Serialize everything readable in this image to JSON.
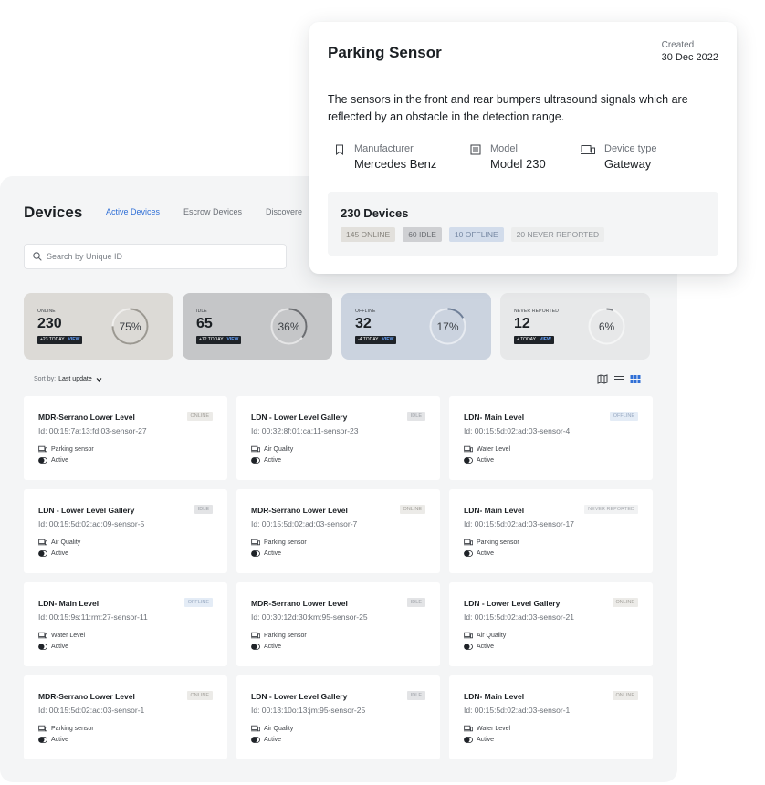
{
  "devices": {
    "title": "Devices",
    "tabs": [
      {
        "label": "Active Devices",
        "active": true
      },
      {
        "label": "Escrow Devices",
        "active": false
      },
      {
        "label": "Discovere",
        "active": false
      }
    ],
    "search": {
      "placeholder": "Search by Unique ID"
    },
    "stats": [
      {
        "label": "ONLINE",
        "value": "230",
        "badge": "+23 TODAY",
        "view": "VIEW",
        "percent": 75,
        "percent_label": "75%",
        "bg": "#dcdad6",
        "ring": "#9b9891"
      },
      {
        "label": "IDLE",
        "value": "65",
        "badge": "+12 TODAY",
        "view": "VIEW",
        "percent": 36,
        "percent_label": "36%",
        "bg": "#c5c6c8",
        "ring": "#6b6d71"
      },
      {
        "label": "OFFLINE",
        "value": "32",
        "badge": "-4 TODAY",
        "view": "VIEW",
        "percent": 17,
        "percent_label": "17%",
        "bg": "#cbd3df",
        "ring": "#6f7f98"
      },
      {
        "label": "NEVER REPORTED",
        "value": "12",
        "badge": "+ TODAY",
        "view": "VIEW",
        "percent": 6,
        "percent_label": "6%",
        "bg": "#e7e8e9",
        "ring": "#7f8287"
      }
    ],
    "sort": {
      "label": "Sort by:",
      "value": "Last update"
    },
    "cards": [
      {
        "name": "MDR-Serrano Lower Level",
        "id": "Id: 00:15:7a:13:fd:03-sensor-27",
        "status": "ONLINE",
        "kind": "online",
        "type": "Parking sensor",
        "state": "Active"
      },
      {
        "name": "LDN - Lower Level Gallery",
        "id": "Id: 00:32:8f:01:ca:11-sensor-23",
        "status": "IDLE",
        "kind": "idle",
        "type": "Air Quality",
        "state": "Active"
      },
      {
        "name": "LDN- Main Level",
        "id": "Id: 00:15:5d:02:ad:03-sensor-4",
        "status": "OFFLINE",
        "kind": "offline",
        "type": "Water Level",
        "state": "Active"
      },
      {
        "name": "LDN - Lower Level Gallery",
        "id": "Id: 00:15:5d:02:ad:09-sensor-5",
        "status": "IDLE",
        "kind": "idle",
        "type": "Air Quality",
        "state": "Active"
      },
      {
        "name": "MDR-Serrano Lower Level",
        "id": "Id: 00:15:5d:02:ad:03-sensor-7",
        "status": "ONLINE",
        "kind": "online",
        "type": "Parking sensor",
        "state": "Active"
      },
      {
        "name": "LDN- Main Level",
        "id": "Id: 00:15:5d:02:ad:03-sensor-17",
        "status": "NEVER REPORTED",
        "kind": "never",
        "type": "Parking sensor",
        "state": "Active"
      },
      {
        "name": "LDN- Main Level",
        "id": "Id: 00:15:9s:11:rm:27-sensor-11",
        "status": "OFFLINE",
        "kind": "offline",
        "type": "Water Level",
        "state": "Active"
      },
      {
        "name": "MDR-Serrano Lower Level",
        "id": "Id: 00:30:12d:30:km:95-sensor-25",
        "status": "IDLE",
        "kind": "idle",
        "type": "Parking sensor",
        "state": "Active"
      },
      {
        "name": "LDN - Lower Level Gallery",
        "id": "Id: 00:15:5d:02:ad:03-sensor-21",
        "status": "ONLINE",
        "kind": "online",
        "type": "Air Quality",
        "state": "Active"
      },
      {
        "name": "MDR-Serrano Lower Level",
        "id": "Id: 00:15:5d:02:ad:03-sensor-1",
        "status": "ONLINE",
        "kind": "online",
        "type": "Parking sensor",
        "state": "Active"
      },
      {
        "name": "LDN - Lower Level Gallery",
        "id": "Id: 00:13:10o:13:jm:95-sensor-25",
        "status": "IDLE",
        "kind": "idle",
        "type": "Air Quality",
        "state": "Active"
      },
      {
        "name": "LDN- Main Level",
        "id": "Id: 00:15:5d:02:ad:03-sensor-1",
        "status": "ONLINE",
        "kind": "online",
        "type": "Water Level",
        "state": "Active"
      }
    ]
  },
  "detail": {
    "title": "Parking Sensor",
    "created_label": "Created",
    "created_date": "30 Dec 2022",
    "description": "The sensors in the front and rear bumpers ultrasound signals which are reflected by an obstacle in the detection range.",
    "meta": [
      {
        "label": "Manufacturer",
        "value": "Mercedes Benz",
        "icon": "bookmark-icon"
      },
      {
        "label": "Model",
        "value": "Model 230",
        "icon": "list-icon"
      },
      {
        "label": "Device type",
        "value": "Gateway",
        "icon": "device-icon"
      }
    ],
    "summary_title": "230 Devices",
    "chips": [
      {
        "label": "145 ONLINE",
        "kind": "online"
      },
      {
        "label": "60 IDLE",
        "kind": "idle"
      },
      {
        "label": "10 OFFLINE",
        "kind": "offline"
      },
      {
        "label": "20 NEVER REPORTED",
        "kind": "never"
      }
    ]
  }
}
